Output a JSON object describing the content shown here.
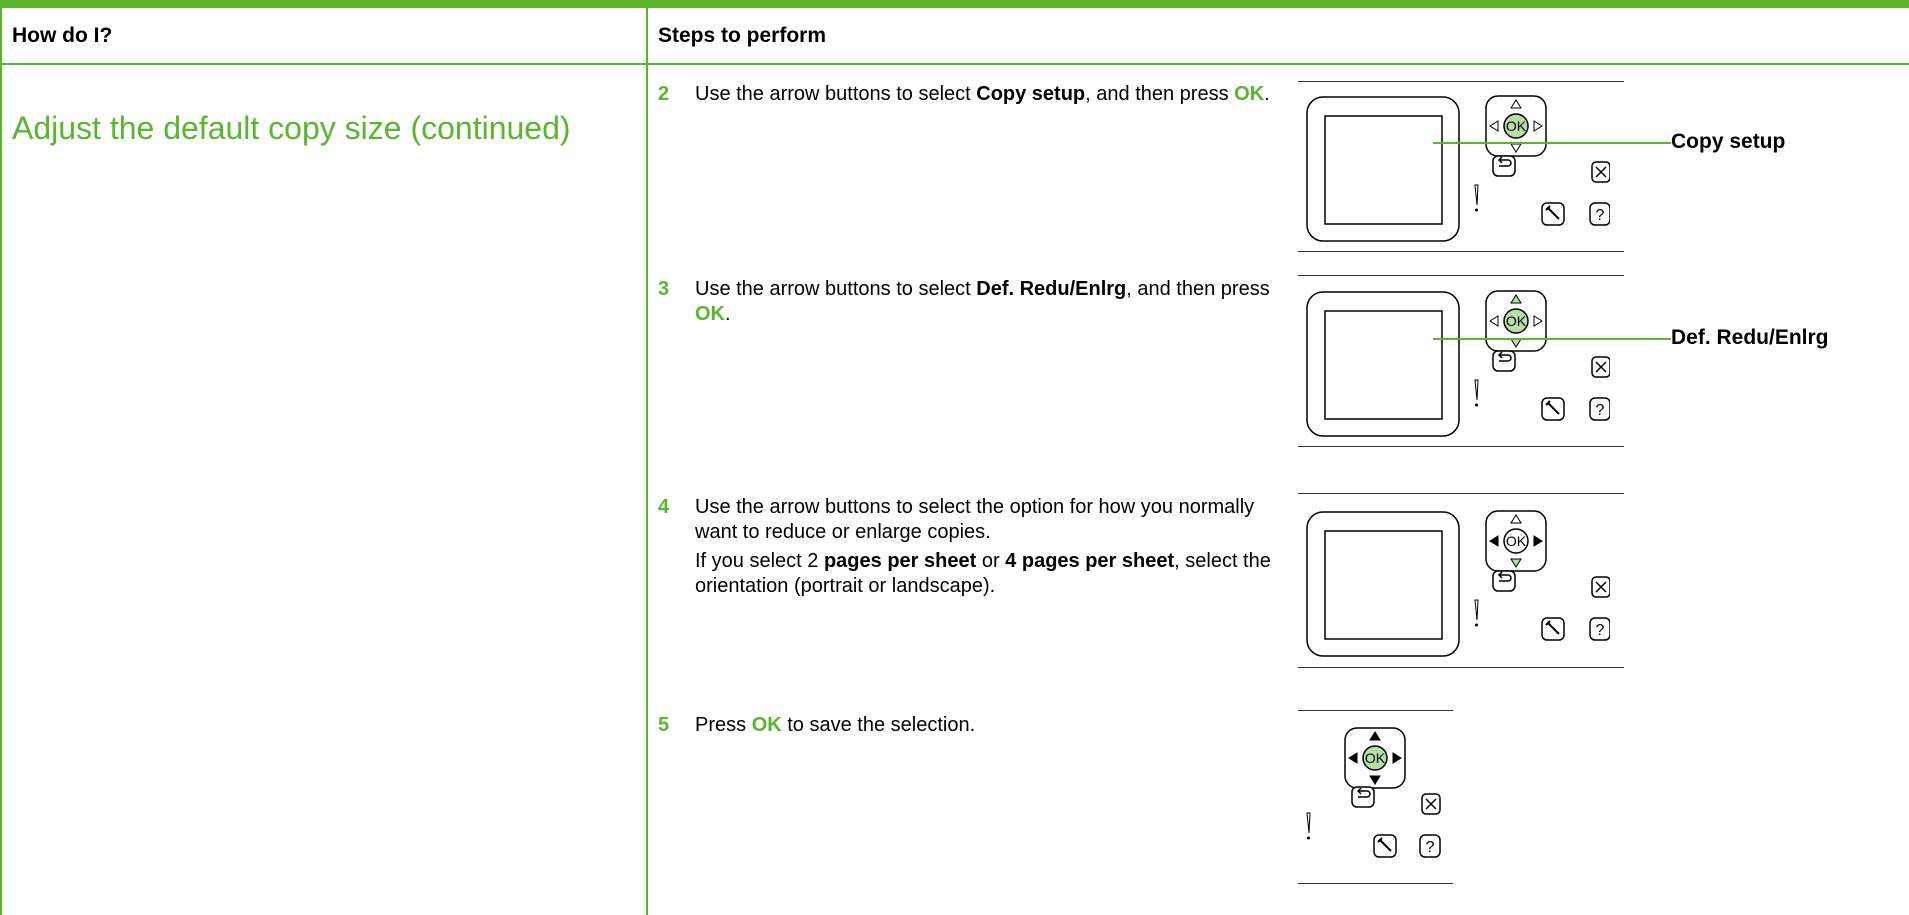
{
  "header": {
    "col1": "How do I?",
    "col2": "Steps to perform"
  },
  "task_title": "Adjust the default copy size (continued)",
  "steps": [
    {
      "num": "2",
      "t1": "Use the arrow buttons to select ",
      "b1": "Copy setup",
      "t2": ", and then press ",
      "ok": "OK",
      "t3": ".",
      "callout": "Copy setup"
    },
    {
      "num": "3",
      "t1": "Use the arrow buttons to select ",
      "b1": "Def. Redu/Enlrg",
      "t2": ", and then press ",
      "ok": "OK",
      "t3": ".",
      "callout": "Def. Redu/Enlrg"
    },
    {
      "num": "4",
      "t1": "Use the arrow buttons to select the option for how you normally want to reduce or enlarge copies.",
      "x1": "If you select 2 ",
      "xb1": "pages per sheet",
      "x2": " or ",
      "xb2": "4 pages per sheet",
      "x3": ", select the orientation (portrait or landscape)."
    },
    {
      "num": "5",
      "t1": "Press ",
      "ok": "OK",
      "t2": " to save the selection."
    }
  ],
  "panel": {
    "ok_label": "OK",
    "help_label": "?",
    "attention_label": "!",
    "icons": [
      "arrow-up-icon",
      "arrow-down-icon",
      "arrow-left-icon",
      "arrow-right-icon",
      "back-icon",
      "cancel-x-icon",
      "wrench-setup-icon",
      "help-icon",
      "attention-light-icon"
    ]
  },
  "colors": {
    "accent": "#5bb52e",
    "ok_fill": "#b9dea5"
  }
}
